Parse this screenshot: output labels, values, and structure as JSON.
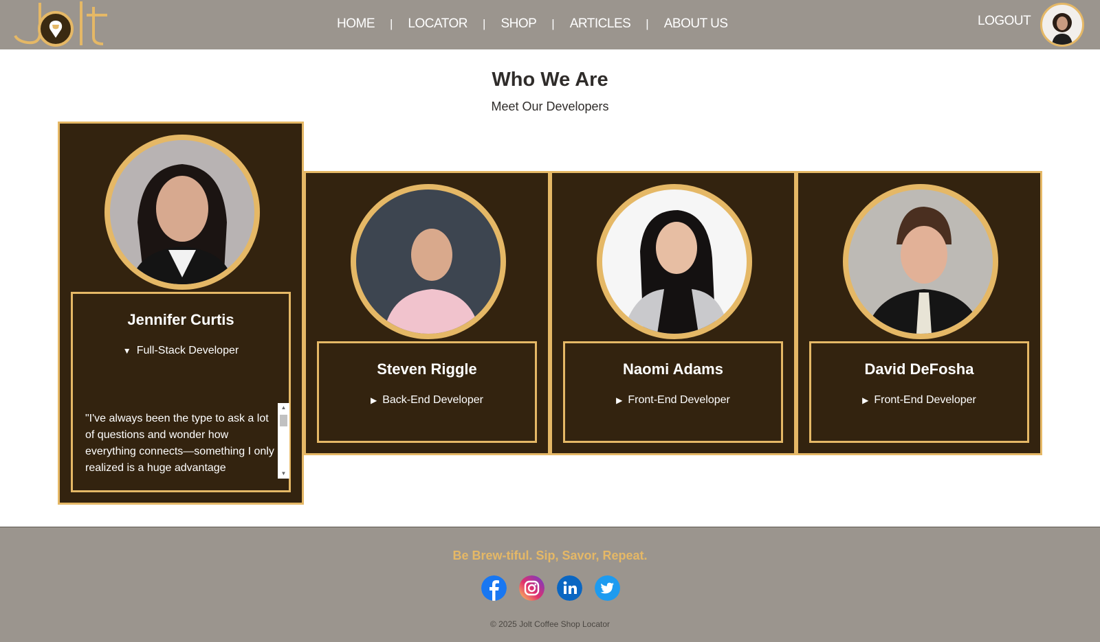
{
  "header": {
    "nav": [
      "HOME",
      "LOCATOR",
      "SHOP",
      "ARTICLES",
      "ABOUT US"
    ],
    "nav_separator": "|",
    "logout_label": "LOGOUT"
  },
  "main": {
    "title": "Who We Are",
    "subtitle": "Meet Our Developers",
    "developers": [
      {
        "name": "Jennifer Curtis",
        "role": "Full-Stack Developer",
        "expanded": true,
        "bio": "\"I've always been the type to ask a lot of questions and wonder how everything connects—something I only realized is a huge advantage"
      },
      {
        "name": "Steven Riggle",
        "role": "Back-End Developer",
        "expanded": false
      },
      {
        "name": "Naomi Adams",
        "role": "Front-End Developer",
        "expanded": false
      },
      {
        "name": "David DeFosha",
        "role": "Front-End Developer",
        "expanded": false
      }
    ]
  },
  "footer": {
    "tagline": "Be Brew-tiful. Sip, Savor, Repeat.",
    "socials": [
      "facebook-icon",
      "instagram-icon",
      "linkedin-icon",
      "twitter-icon"
    ],
    "copyright": "© 2025 Jolt Coffee Shop Locator"
  },
  "colors": {
    "header_bg": "#9b958e",
    "card_bg": "#33230f",
    "accent_gold": "#e5b866"
  }
}
